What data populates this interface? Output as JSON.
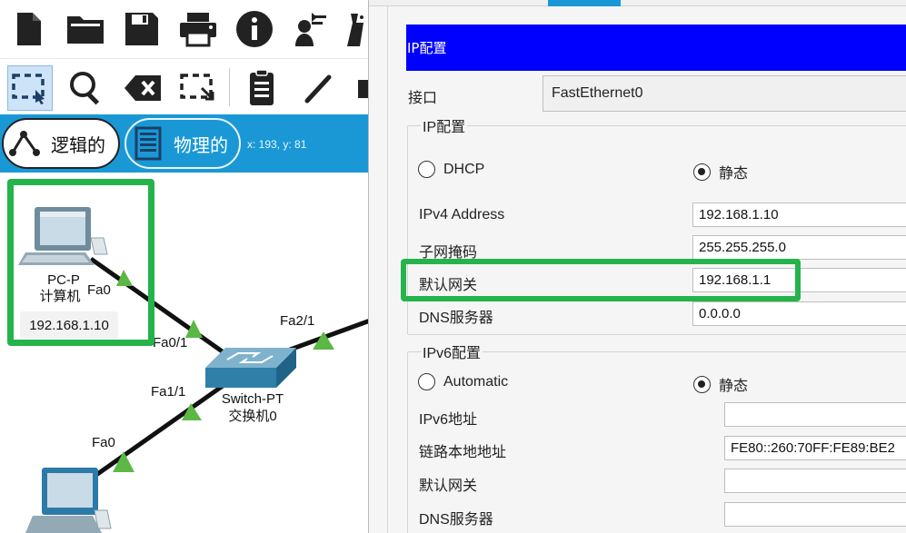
{
  "toolbar": {
    "row1": [
      {
        "name": "new-file-icon"
      },
      {
        "name": "open-folder-icon"
      },
      {
        "name": "save-icon"
      },
      {
        "name": "print-icon"
      },
      {
        "name": "info-icon"
      },
      {
        "name": "activity-wizard-icon"
      },
      {
        "name": "custom-device-icon"
      }
    ],
    "row2": [
      {
        "name": "select-tool-icon",
        "selected": true
      },
      {
        "name": "inspect-icon"
      },
      {
        "name": "delete-icon"
      },
      {
        "name": "resize-shape-icon"
      },
      {
        "name": "place-note-icon"
      },
      {
        "name": "draw-line-icon"
      },
      {
        "name": "draw-shape-icon"
      }
    ]
  },
  "view_tabs": {
    "logical": "逻辑的",
    "physical": "物理的"
  },
  "coordinates": "x: 193, y: 81",
  "topology": {
    "pc0": {
      "model": "PC-P",
      "name": "计算机",
      "ip": "192.168.1.10",
      "port": "Fa0"
    },
    "switch": {
      "model": "Switch-PT",
      "name": "交换机0",
      "ports": [
        "Fa0/1",
        "Fa1/1",
        "Fa2/1"
      ]
    },
    "pc1": {
      "port": "Fa0"
    },
    "link_color": "#111111",
    "link_light_color": "#5cb845",
    "highlight_color": "#25b34b"
  },
  "dialog": {
    "title": "IP配置",
    "interface_label": "接口",
    "interface_value": "FastEthernet0",
    "ipv4_group": {
      "legend": "IP配置",
      "dhcp_label": "DHCP",
      "static_label": "静态",
      "selected": "static",
      "ipv4_address_label": "IPv4 Address",
      "ipv4_address": "192.168.1.10",
      "subnet_label": "子网掩码",
      "subnet": "255.255.255.0",
      "gateway_label": "默认网关",
      "gateway": "192.168.1.1",
      "dns_label": "DNS服务器",
      "dns": "0.0.0.0"
    },
    "ipv6_group": {
      "legend": "IPv6配置",
      "auto_label": "Automatic",
      "static_label": "静态",
      "selected": "static",
      "ipv6_address_label": "IPv6地址",
      "ipv6_address": "",
      "link_local_label": "链路本地地址",
      "link_local": "FE80::260:70FF:FE89:BE2",
      "gateway_label": "默认网关",
      "gateway": "",
      "dns_label": "DNS服务器",
      "dns": ""
    },
    "title_bar_color": "#0000ff"
  }
}
